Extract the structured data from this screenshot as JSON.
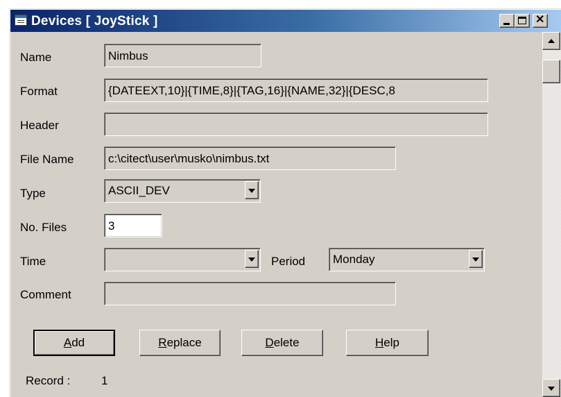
{
  "window": {
    "title": "Devices [ JoyStick ]",
    "minimize": "minimize",
    "maximize": "maximize",
    "close": "close"
  },
  "form": {
    "name": {
      "label": "Name",
      "value": "Nimbus"
    },
    "format": {
      "label": "Format",
      "value": "{DATEEXT,10}|{TIME,8}|{TAG,16}|{NAME,32}|{DESC,8"
    },
    "header": {
      "label": "Header",
      "value": ""
    },
    "file_name": {
      "label": "File Name",
      "value": "c:\\citect\\user\\musko\\nimbus.txt"
    },
    "type": {
      "label": "Type",
      "value": "ASCII_DEV"
    },
    "no_files": {
      "label": "No. Files",
      "value": "3"
    },
    "time": {
      "label": "Time",
      "value": ""
    },
    "period": {
      "label": "Period",
      "value": "Monday"
    },
    "comment": {
      "label": "Comment",
      "value": ""
    }
  },
  "buttons": {
    "add": {
      "accel": "A",
      "rest": "dd"
    },
    "replace": {
      "accel": "R",
      "rest": "eplace"
    },
    "delete": {
      "accel": "D",
      "rest": "elete"
    },
    "help": {
      "accel": "H",
      "rest": "elp"
    }
  },
  "status": {
    "record_label": "Record :",
    "record_value": "1"
  },
  "icons": {
    "window_icon": "window-icon",
    "dropdown": "chevron-down-icon",
    "scroll_up": "arrow-up-icon",
    "scroll_down": "arrow-down-icon"
  },
  "colors": {
    "title_gradient_start": "#0a246a",
    "title_gradient_end": "#a6caf0",
    "face": "#d4d0c8"
  }
}
